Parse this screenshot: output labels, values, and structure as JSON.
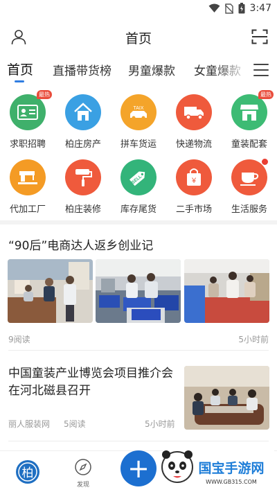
{
  "status": {
    "time": "3:47"
  },
  "header": {
    "title": "首页"
  },
  "tabs": [
    {
      "label": "首页",
      "active": true
    },
    {
      "label": "直播带货榜"
    },
    {
      "label": "男童爆款"
    },
    {
      "label": "女童爆款"
    }
  ],
  "categories": [
    {
      "label": "求职招聘",
      "icon": "id-card-icon",
      "color": "#3fb06b",
      "badge": "最热"
    },
    {
      "label": "柏庄房产",
      "icon": "house-icon",
      "color": "#3aa0e3"
    },
    {
      "label": "拼车货运",
      "icon": "taxi-icon",
      "color": "#f4a42a",
      "icon_text": "TAIX"
    },
    {
      "label": "快递物流",
      "icon": "truck-icon",
      "color": "#ef5a3c"
    },
    {
      "label": "童装配套",
      "icon": "store-icon",
      "color": "#3dbb74",
      "badge": "最热"
    },
    {
      "label": "代加工厂",
      "icon": "sewing-machine-icon",
      "color": "#f49b25"
    },
    {
      "label": "柏庄装修",
      "icon": "paint-roller-icon",
      "color": "#ef5a3c"
    },
    {
      "label": "库存尾货",
      "icon": "sell-tag-icon",
      "color": "#33b47a",
      "icon_text": "SELL"
    },
    {
      "label": "二手市场",
      "icon": "shopping-bag-icon",
      "color": "#ef5a3c",
      "icon_text": "¥"
    },
    {
      "label": "生活服务",
      "icon": "coffee-cup-icon",
      "color": "#ef5a3c",
      "dot": true
    }
  ],
  "article1": {
    "title": "“90后”电商达人返乡创业记",
    "reads": "9阅读",
    "time": "5小时前"
  },
  "article2": {
    "title": "中国童装产业博览会项目推介会在河北磁县召开",
    "source": "丽人服装网",
    "reads": "5阅读",
    "time": "5小时前"
  },
  "bottom_nav": {
    "home_label": "柏",
    "discover_label": "发现",
    "add_label": "+"
  },
  "watermark": {
    "text": "国宝手游网",
    "url": "WWW.GB315.COM"
  },
  "colors": {
    "accent": "#2f7de1",
    "hot": "#e94d3c"
  }
}
